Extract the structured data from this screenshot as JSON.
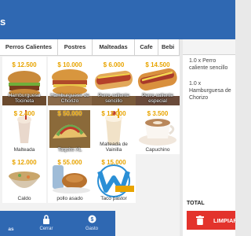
{
  "header": {
    "title": "s"
  },
  "categories": [
    "Perros Calientes",
    "Postres",
    "Malteadas",
    "Cafe",
    "Bebi"
  ],
  "products": [
    {
      "price": "$ 12.500",
      "name": "Hamburguesa Tocineta"
    },
    {
      "price": "$ 10.000",
      "name": "Hamburguesa de Chorizo"
    },
    {
      "price": "$ 6.000",
      "name": "Perro caliente sencillo"
    },
    {
      "price": "$ 14.500",
      "name": "Perro caliente especial"
    },
    {
      "price": "$ 2.400",
      "name": "Malteada"
    },
    {
      "price": "$ 50.000",
      "name": "Taquito XL"
    },
    {
      "price": "$ 12.000",
      "name": "Malteada de Vainilla"
    },
    {
      "price": "$ 3.500",
      "name": "Capuchino"
    },
    {
      "price": "$ 12.000",
      "name": "Caldo"
    },
    {
      "price": "$ 55.000",
      "name": "pollo asado"
    },
    {
      "price": "$ 15.000",
      "name": "Taco pastor"
    }
  ],
  "order": {
    "items": [
      "1.0 x Perro caliente sencillo",
      "1.0 x Hamburguesa de Chorizo"
    ],
    "total_label": "TOTAL",
    "clear_label": "LIMPIAR"
  },
  "nav": {
    "first_label": "as",
    "close_label": "Cerrar",
    "expense_label": "Gasto"
  },
  "colors": {
    "primary": "#2f68b2",
    "price": "#e8a400",
    "danger": "#e3332c"
  }
}
